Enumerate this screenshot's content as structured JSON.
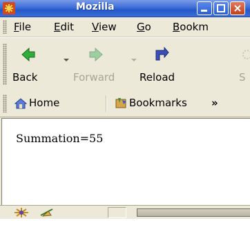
{
  "window": {
    "title": "Mozilla",
    "controls": [
      "minimize-icon",
      "maximize-icon",
      "close-icon"
    ]
  },
  "menubar": {
    "items": [
      {
        "label": "File",
        "underline": "F"
      },
      {
        "label": "Edit",
        "underline": "E"
      },
      {
        "label": "View",
        "underline": "V"
      },
      {
        "label": "Go",
        "underline": "G"
      },
      {
        "label": "Bookm",
        "underline": "B"
      }
    ]
  },
  "navbar": {
    "back_label": "Back",
    "forward_label": "Forward",
    "reload_label": "Reload",
    "stop_label": "S"
  },
  "personalbar": {
    "home_label": "Home",
    "bookmarks_label": "Bookmarks",
    "overflow_label": "»"
  },
  "content": {
    "text": "Summation=55"
  },
  "statusbar": {
    "icons": [
      "navigator-icon",
      "mail-icon"
    ]
  }
}
